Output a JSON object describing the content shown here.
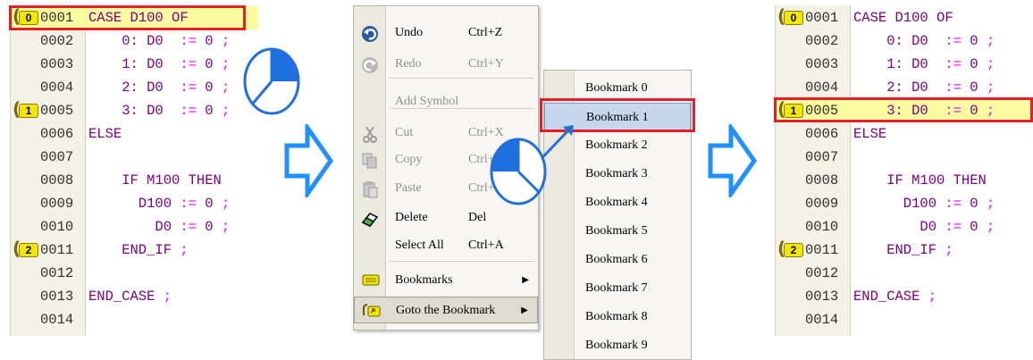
{
  "colors": {
    "highlight_bg": "#fbfba0",
    "bookmark_tag": "#f3e600",
    "annotation_red": "#e41e26",
    "arrow_blue": "#1e90ff",
    "hover_blue": "#c6d7ee"
  },
  "editor_lines": [
    {
      "num": "0001",
      "code": "CASE D100 OF",
      "bookmark": "0"
    },
    {
      "num": "0002",
      "code": "    0: D0  := 0 ;",
      "bookmark": ""
    },
    {
      "num": "0003",
      "code": "    1: D0  := 0 ;",
      "bookmark": ""
    },
    {
      "num": "0004",
      "code": "    2: D0  := 0 ;",
      "bookmark": ""
    },
    {
      "num": "0005",
      "code": "    3: D0  := 0 ;",
      "bookmark": "1"
    },
    {
      "num": "0006",
      "code": "ELSE",
      "bookmark": ""
    },
    {
      "num": "0007",
      "code": "",
      "bookmark": ""
    },
    {
      "num": "0008",
      "code": "    IF M100 THEN",
      "bookmark": ""
    },
    {
      "num": "0009",
      "code": "      D100 := 0 ;",
      "bookmark": ""
    },
    {
      "num": "0010",
      "code": "        D0 := 0 ;",
      "bookmark": ""
    },
    {
      "num": "0011",
      "code": "    END_IF ;",
      "bookmark": "2"
    },
    {
      "num": "0012",
      "code": "",
      "bookmark": ""
    },
    {
      "num": "0013",
      "code": "END_CASE ;",
      "bookmark": ""
    },
    {
      "num": "0014",
      "code": "",
      "bookmark": ""
    }
  ],
  "left_editor": {
    "highlighted_line": "0001"
  },
  "right_editor": {
    "highlighted_line": "0005"
  },
  "context_menu": {
    "items": [
      {
        "label": "Undo",
        "shortcut": "Ctrl+Z",
        "icon": "undo-icon",
        "disabled": false
      },
      {
        "label": "Redo",
        "shortcut": "Ctrl+Y",
        "icon": "redo-icon",
        "disabled": true
      },
      {
        "label": "Add Symbol",
        "shortcut": "",
        "icon": "",
        "disabled": true
      },
      {
        "label": "Cut",
        "shortcut": "Ctrl+X",
        "icon": "cut-icon",
        "disabled": true
      },
      {
        "label": "Copy",
        "shortcut": "Ctrl+C",
        "icon": "copy-icon",
        "disabled": true
      },
      {
        "label": "Paste",
        "shortcut": "Ctrl+V",
        "icon": "paste-icon",
        "disabled": true
      },
      {
        "label": "Delete",
        "shortcut": "Del",
        "icon": "eraser-icon",
        "disabled": false
      },
      {
        "label": "Select All",
        "shortcut": "Ctrl+A",
        "icon": "",
        "disabled": false
      },
      {
        "label": "Bookmarks",
        "shortcut": "",
        "icon": "bookmark-icon",
        "disabled": false,
        "submenu": true
      },
      {
        "label": "Goto the Bookmark",
        "shortcut": "",
        "icon": "goto-bookmark-icon",
        "disabled": false,
        "submenu": true,
        "active": true
      }
    ]
  },
  "bookmark_submenu": {
    "items": [
      "Bookmark 0",
      "Bookmark 1",
      "Bookmark 2",
      "Bookmark 3",
      "Bookmark 4",
      "Bookmark 5",
      "Bookmark 6",
      "Bookmark 7",
      "Bookmark 8",
      "Bookmark 9"
    ],
    "selected": "Bookmark 1"
  }
}
